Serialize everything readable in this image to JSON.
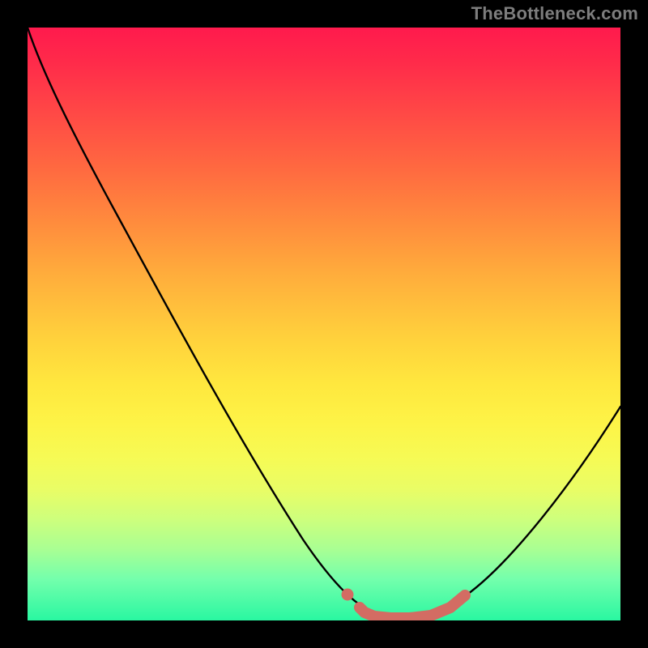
{
  "watermark": "TheBottleneck.com",
  "colors": {
    "curve": "#000000",
    "marker": "#d36c63",
    "gradient_top": "#ff1a4d",
    "gradient_bottom": "#29f7a1",
    "page_bg": "#000000"
  },
  "chart_data": {
    "type": "line",
    "title": "",
    "xlabel": "",
    "ylabel": "",
    "xlim": [
      0,
      100
    ],
    "ylim": [
      0,
      100
    ],
    "grid": false,
    "background": "vertical gradient red→orange→yellow→green (bottleneck heatmap)",
    "series": [
      {
        "name": "bottleneck-percentage",
        "x": [
          0,
          5,
          10,
          15,
          20,
          25,
          30,
          35,
          40,
          45,
          50,
          55,
          60,
          63,
          65,
          68,
          72,
          76,
          82,
          88,
          94,
          100
        ],
        "values": [
          100,
          93,
          85,
          78,
          70,
          62,
          54,
          46,
          37,
          28,
          19,
          10,
          4,
          1,
          0,
          0,
          2,
          6,
          14,
          23,
          30,
          36
        ]
      }
    ],
    "annotations": [
      {
        "name": "optimal-range",
        "x_range": [
          55,
          74
        ],
        "y_level": 0,
        "style": "thick salmon stroke along curve bottom"
      },
      {
        "name": "optimal-point-dot",
        "x": 54,
        "y": 4,
        "style": "salmon filled circle"
      }
    ]
  }
}
